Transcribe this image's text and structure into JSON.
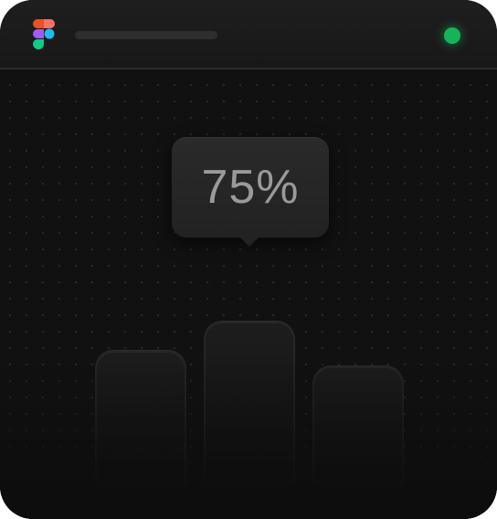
{
  "window": {
    "status_color": "#16b45a"
  },
  "icons": {
    "app_logo": "figma-logo-icon",
    "status_indicator": "status-dot-icon"
  },
  "tooltip": {
    "value": "75%"
  },
  "chart": {
    "bar_levels": [
      0.68,
      0.8,
      0.62
    ],
    "highlighted_index": 1
  }
}
